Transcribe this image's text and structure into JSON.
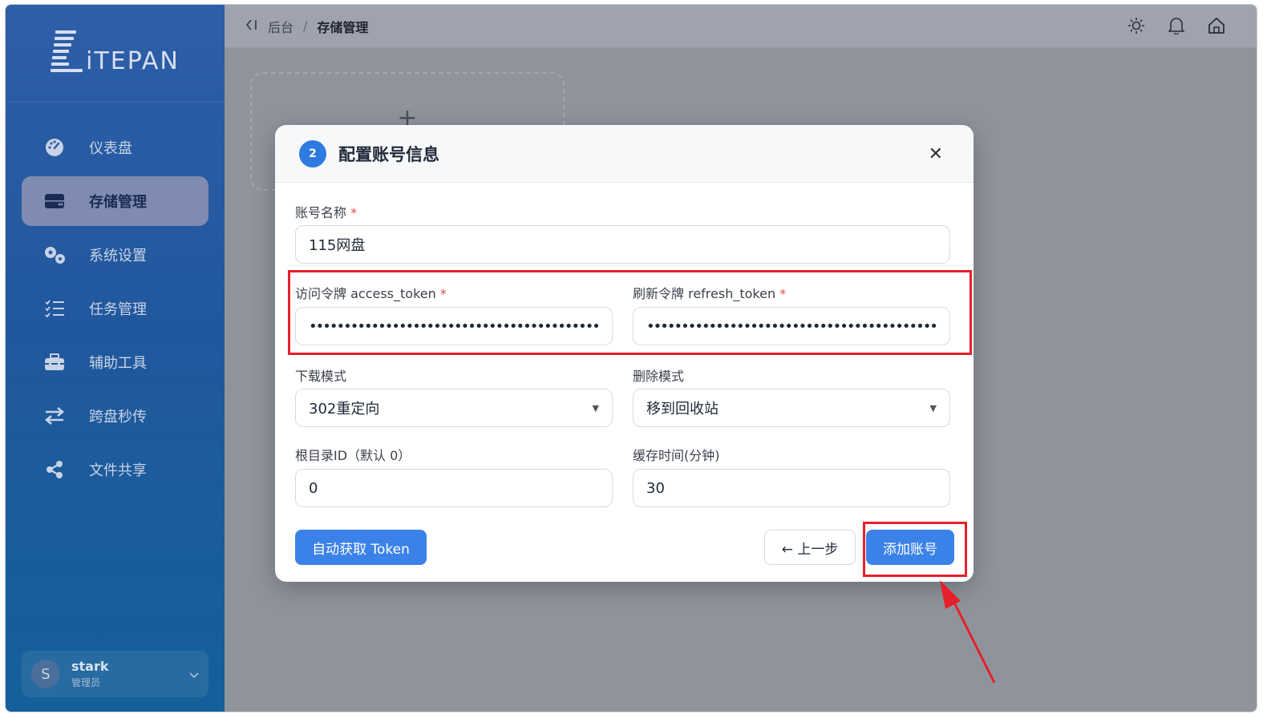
{
  "app": {
    "logo_text": "iTEPAN"
  },
  "sidebar": {
    "items": [
      {
        "label": "仪表盘",
        "icon": "dashboard-gauge-icon"
      },
      {
        "label": "存储管理",
        "icon": "storage-drive-icon",
        "active": true
      },
      {
        "label": "系统设置",
        "icon": "gears-icon"
      },
      {
        "label": "任务管理",
        "icon": "task-list-icon"
      },
      {
        "label": "辅助工具",
        "icon": "toolbox-icon"
      },
      {
        "label": "跨盘秒传",
        "icon": "transfer-arrows-icon"
      },
      {
        "label": "文件共享",
        "icon": "share-icon"
      }
    ],
    "user": {
      "avatar_letter": "S",
      "name": "stark",
      "role": "管理员"
    }
  },
  "topbar": {
    "breadcrumb": {
      "root": "后台",
      "separator": "/",
      "current": "存储管理"
    },
    "icons": [
      "sun-icon",
      "bell-icon",
      "home-icon"
    ]
  },
  "main": {
    "add_card_symbol": "+"
  },
  "modal": {
    "step_number": "2",
    "title": "配置账号信息",
    "close_symbol": "✕",
    "fields": {
      "account_name": {
        "label": "账号名称",
        "required_mark": "*",
        "value": "115网盘"
      },
      "access_token": {
        "label": "访问令牌 access_token",
        "required_mark": "*",
        "value": "••••••••••••••••••••••••••••••••••••••••••••••••••••••••••••••"
      },
      "refresh_token": {
        "label": "刷新令牌 refresh_token",
        "required_mark": "*",
        "value": "••••••••••••••••••••••••••••••••••••••••••••••••••••••••••••••"
      },
      "download_mode": {
        "label": "下载模式",
        "value": "302重定向"
      },
      "delete_mode": {
        "label": "删除模式",
        "value": "移到回收站"
      },
      "root_dir_id": {
        "label": "根目录ID（默认 0）",
        "value": "0"
      },
      "cache_time": {
        "label": "缓存时间(分钟)",
        "value": "30"
      }
    },
    "buttons": {
      "auto_token": "自动获取 Token",
      "prev_step": "← 上一步",
      "add_account": "添加账号"
    }
  },
  "colors": {
    "primary": "#3b82e8",
    "annotation_red": "#e5202b",
    "required": "#e5484d"
  }
}
